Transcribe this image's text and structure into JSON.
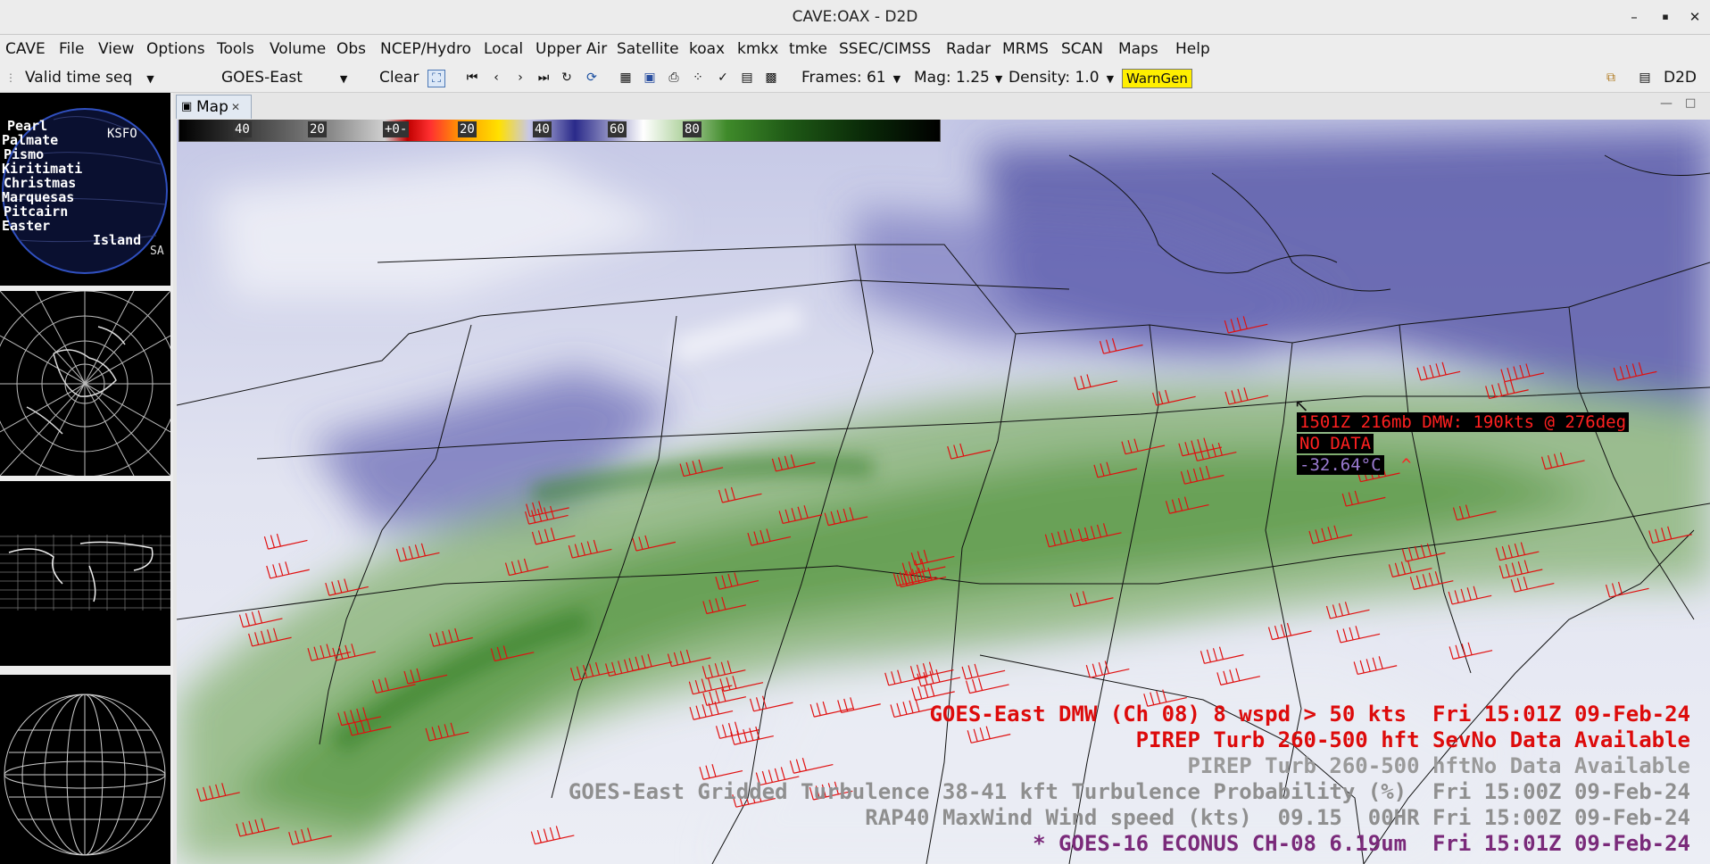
{
  "window": {
    "title": "CAVE:OAX - D2D",
    "minimize": "–",
    "maximize": "▪",
    "close": "✕"
  },
  "menu": [
    "CAVE",
    "File",
    "View",
    "Options",
    "Tools",
    "Volume",
    "Obs",
    "NCEP/Hydro",
    "Local",
    "Upper Air",
    "Satellite",
    "koax",
    "kmkx",
    "tmke",
    "SSEC/CIMSS",
    "Radar",
    "MRMS",
    "SCAN",
    "Maps",
    "Help"
  ],
  "toolbar": {
    "time_mode": "Valid time seq",
    "satellite": "GOES-East",
    "clear": "Clear",
    "frames": "Frames: 61",
    "mag": "Mag: 1.25",
    "density": "Density: 1.0",
    "warngen": "WarnGen",
    "perspective": "D2D"
  },
  "tab": {
    "label": "Map",
    "close": "✕"
  },
  "thumbnails": {
    "pacific_labels": [
      "Pearl",
      "Palmate",
      "Pismo",
      "Kiritimati",
      "Christmas",
      "Marquesas",
      "Pitcairn",
      "Easter",
      "Island"
    ],
    "pacific_station": "KSFO",
    "pacific_corner": "SA"
  },
  "colorbar": {
    "ticks": [
      "40",
      "20",
      "+0-",
      "20",
      "40",
      "60",
      "80"
    ]
  },
  "sample": {
    "line1": "1501Z 216mb DMW: 190kts @ 276deg",
    "line2": "NO DATA",
    "line3": "-32.64°C",
    "line3_suffix": "^"
  },
  "legend": [
    {
      "text": "GOES-East DMW (Ch 08) 8 wspd > 50 kts  Fri 15:01Z 09-Feb-24",
      "color": "#dd0b0b"
    },
    {
      "text": "PIREP Turb 260-500 hft SevNo Data Available",
      "color": "#dd0b0b"
    },
    {
      "text": "PIREP Turb 260-500 hftNo Data Available",
      "color": "#9a9a9a"
    },
    {
      "text": "GOES-East Gridded Turbulence 38-41 kft Turbulence Probability (%)  Fri 15:00Z 09-Feb-24",
      "color": "#8f8f8f"
    },
    {
      "text": "RAP40 MaxWind Wind speed (kts)  09.15  00HR Fri 15:00Z 09-Feb-24",
      "color": "#8f8f8f"
    },
    {
      "text": "* GOES-16 ECONUS CH-08 6.19um  Fri 15:01Z 09-Feb-24",
      "color": "#7a2a7a"
    }
  ],
  "colors": {
    "barb": "#e01010",
    "plume": "#3f8a2a",
    "dry": "#3a3a90",
    "legend_red": "#dd0b0b"
  }
}
